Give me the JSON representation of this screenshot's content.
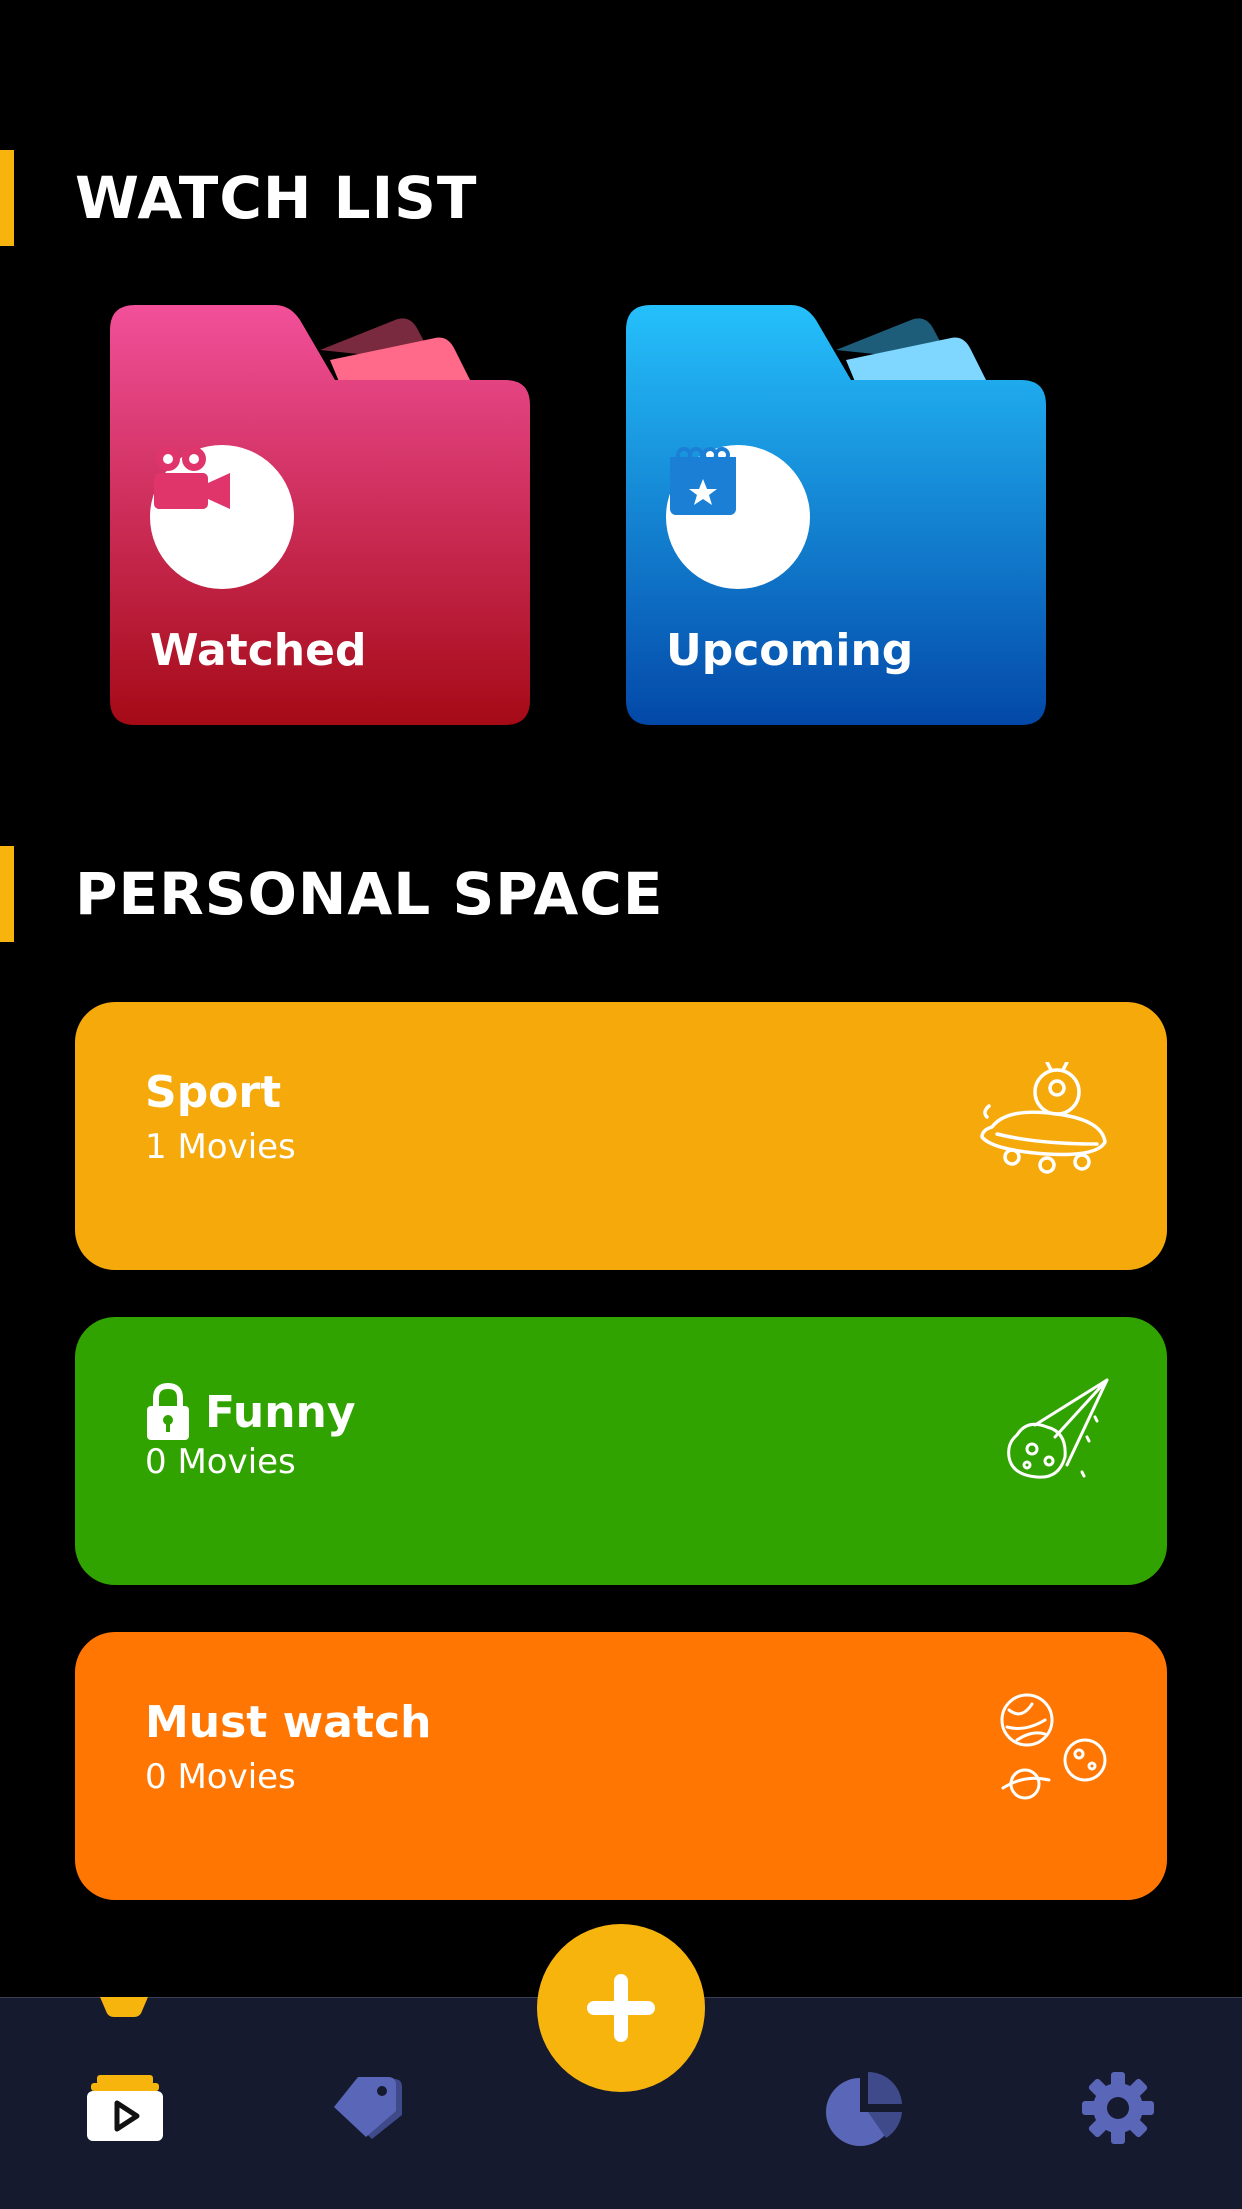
{
  "watch_list": {
    "title": "WATCH LIST",
    "folders": [
      {
        "label": "Watched",
        "icon": "video-camera-icon",
        "color": "#e0356b"
      },
      {
        "label": "Upcoming",
        "icon": "calendar-star-icon",
        "color": "#1b8de0"
      }
    ]
  },
  "personal_space": {
    "title": "PERSONAL SPACE",
    "items": [
      {
        "title": "Sport",
        "count": "1 Movies",
        "color": "#f6a90b",
        "locked": false,
        "icon": "ufo-icon"
      },
      {
        "title": "Funny",
        "count": "0 Movies",
        "color": "#31a300",
        "locked": true,
        "icon": "meteor-icon"
      },
      {
        "title": "Must watch",
        "count": "0 Movies",
        "color": "#ff7702",
        "locked": false,
        "icon": "planets-icon"
      }
    ]
  },
  "tabbar": {
    "tabs": [
      "movies-tab-icon",
      "tags-tab-icon",
      "stats-tab-icon",
      "settings-tab-icon"
    ],
    "active": "movies-tab-icon",
    "fab_icon": "plus-icon"
  },
  "colors": {
    "accent": "#f6b40d",
    "tabbar_bg": "#151a2e",
    "tab_icon": "#5a67b8"
  }
}
